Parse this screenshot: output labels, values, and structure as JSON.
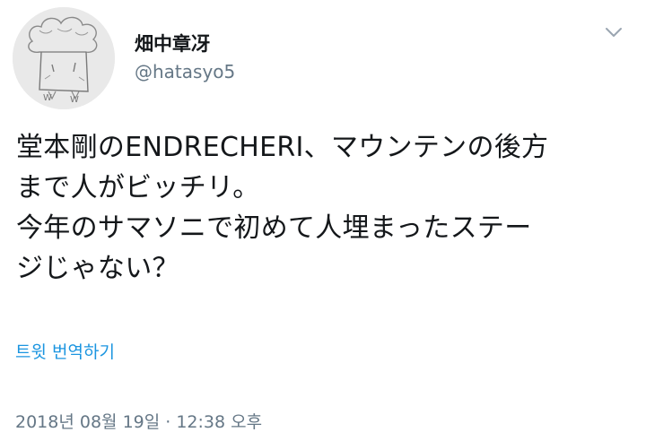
{
  "author": {
    "display_name": "畑中章冴",
    "handle": "@hatasyo5",
    "avatar_icon": "hand-drawn-cloud-face-avatar"
  },
  "tweet": {
    "lines": [
      "堂本剛のENDRECHERI、マウンテンの後方",
      "まで人がビッチリ。",
      "今年のサマソニで初めて人埋まったステー",
      "ジじゃない？"
    ],
    "translate_label": "트윗 번역하기",
    "timestamp": "2018년 08월 19일 · 12:38 오후"
  },
  "icons": {
    "more_menu": "chevron-down-icon"
  },
  "colors": {
    "text": "#14171a",
    "secondary": "#657786",
    "link": "#1b95e0"
  }
}
